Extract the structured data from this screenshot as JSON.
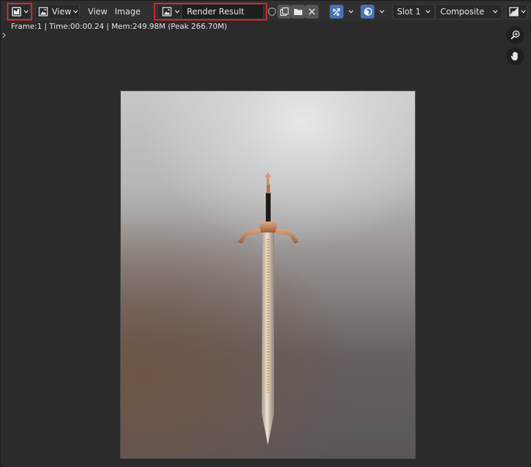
{
  "header": {
    "editor_type_icon": "image-editor-icon",
    "view_mode_label": "View",
    "menus": [
      "View",
      "Image"
    ],
    "image_name": "Render Result",
    "slot_label": "Slot 1",
    "layer_label": "Composite"
  },
  "info_text": "Frame:1 | Time:00:00.24 | Mem:249.98M (Peak 266.70M)",
  "icons": {
    "image_browse": "image-icon",
    "fake_user": "shield-icon",
    "duplicate": "duplicate-icon",
    "open": "folder-icon",
    "unlink": "close-icon",
    "gizmo": "gizmo-icon",
    "overlay": "overlay-icon",
    "display_channels": "display-channels-icon",
    "zoom": "zoom-icon",
    "pan": "hand-icon"
  },
  "colors": {
    "highlight": "#d9252a",
    "active_toggle": "#4772b3",
    "header_bg": "#303030",
    "canvas_bg": "#2b2b2b"
  }
}
